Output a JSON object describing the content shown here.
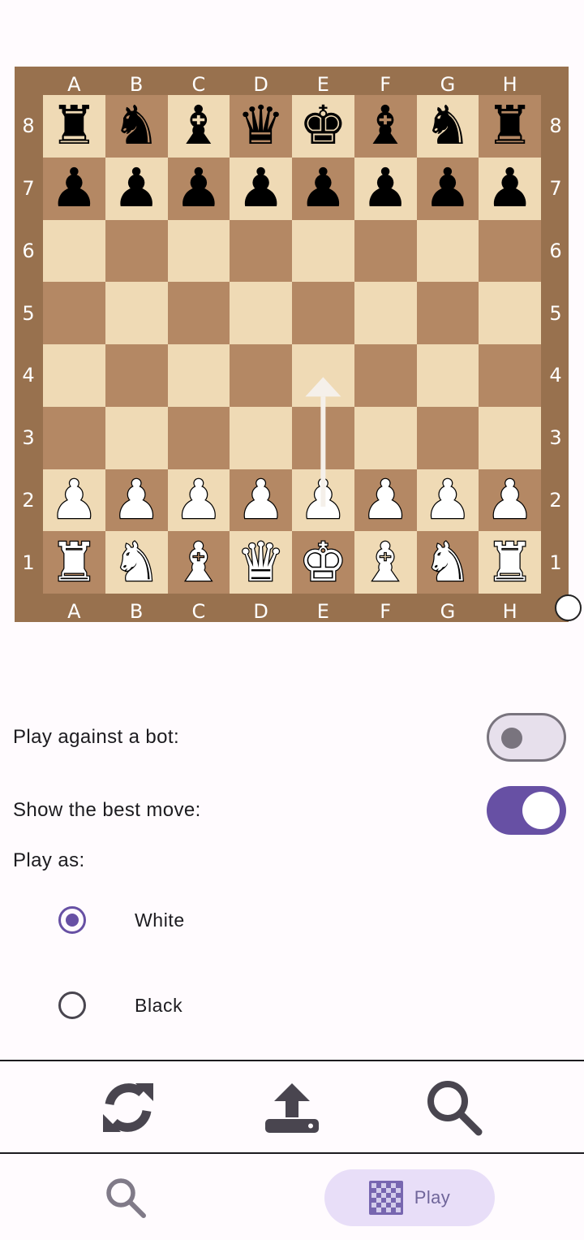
{
  "board": {
    "files": [
      "A",
      "B",
      "C",
      "D",
      "E",
      "F",
      "G",
      "H"
    ],
    "ranks": [
      "8",
      "7",
      "6",
      "5",
      "4",
      "3",
      "2",
      "1"
    ],
    "position": [
      [
        "br",
        "bn",
        "bb",
        "bq",
        "bk",
        "bb",
        "bn",
        "br"
      ],
      [
        "bp",
        "bp",
        "bp",
        "bp",
        "bp",
        "bp",
        "bp",
        "bp"
      ],
      [
        "",
        "",
        "",
        "",
        "",
        "",
        "",
        ""
      ],
      [
        "",
        "",
        "",
        "",
        "",
        "",
        "",
        ""
      ],
      [
        "",
        "",
        "",
        "",
        "",
        "",
        "",
        ""
      ],
      [
        "",
        "",
        "",
        "",
        "",
        "",
        "",
        ""
      ],
      [
        "wp",
        "wp",
        "wp",
        "wp",
        "wp",
        "wp",
        "wp",
        "wp"
      ],
      [
        "wr",
        "wn",
        "wb",
        "wq",
        "wk",
        "wb",
        "wn",
        "wr"
      ]
    ],
    "best_move_arrow": {
      "from": "E2",
      "to": "E4"
    },
    "side_to_move": "white",
    "colors": {
      "frame": "#98714e",
      "light": "#efdab5",
      "dark": "#b48864",
      "arrow": "#f5f0ea"
    }
  },
  "settings": {
    "bot_label": "Play against a bot:",
    "bot_enabled": false,
    "best_move_label": "Show the best move:",
    "best_move_enabled": true,
    "play_as_label": "Play as:",
    "options": [
      {
        "label": "White",
        "selected": true
      },
      {
        "label": "Black",
        "selected": false
      }
    ]
  },
  "actions": {
    "icons": [
      "refresh-icon",
      "upload-icon",
      "search-icon"
    ]
  },
  "nav": {
    "items": [
      {
        "icon": "search-icon",
        "label": ""
      },
      {
        "icon": "chessboard-icon",
        "label": "Play",
        "active": true
      }
    ]
  },
  "colors": {
    "accent": "#6750a4",
    "background": "#fffbfe",
    "nav_active_bg": "#e8def8"
  }
}
